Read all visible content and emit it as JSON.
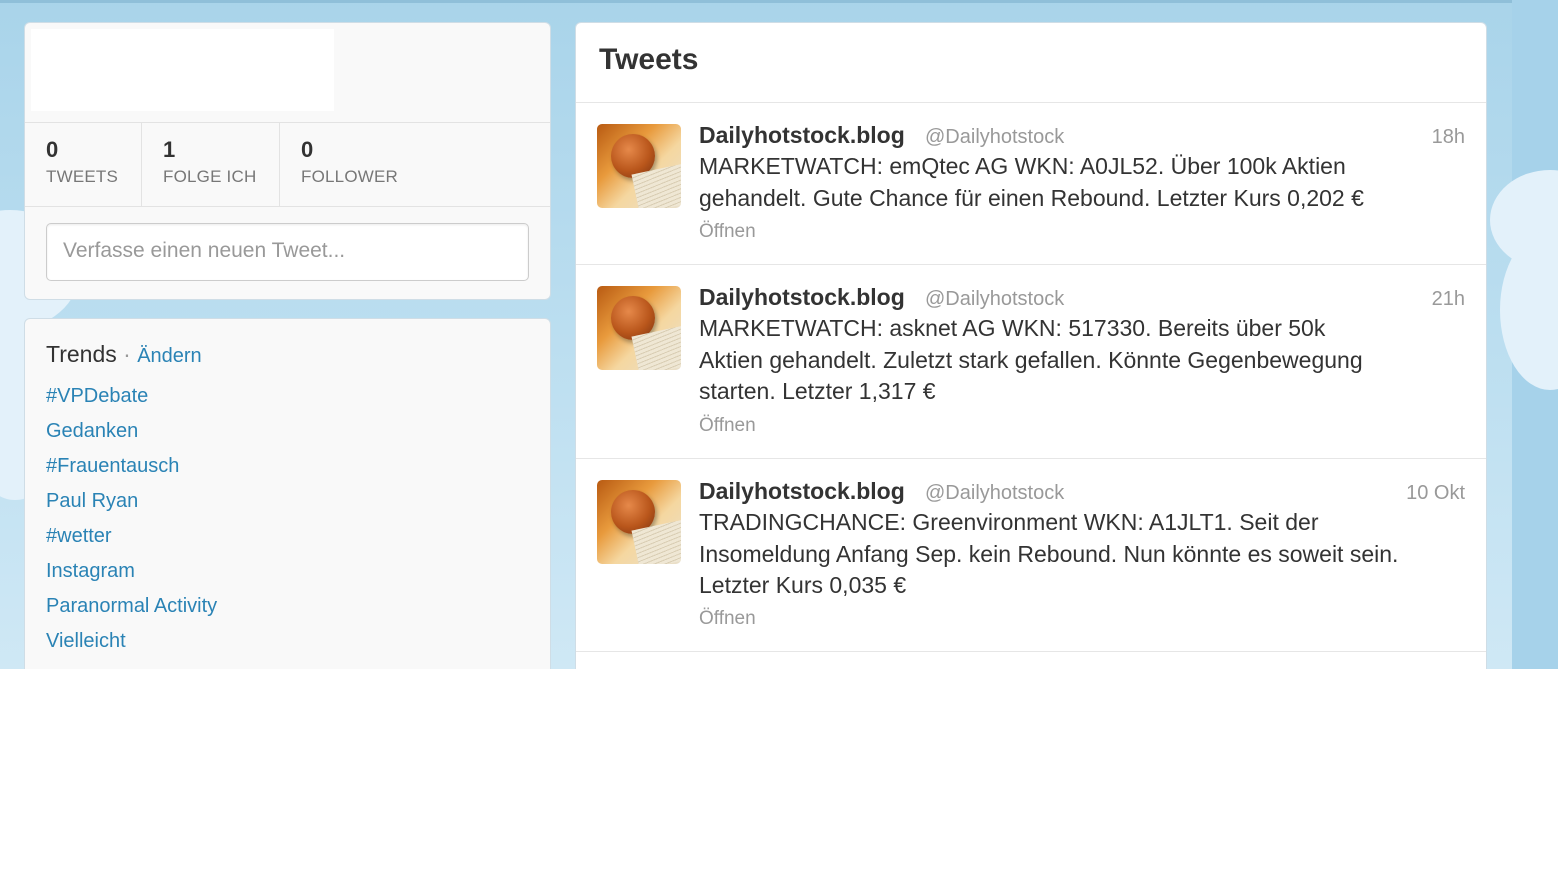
{
  "profile": {
    "stats": [
      {
        "num": "0",
        "label": "TWEETS"
      },
      {
        "num": "1",
        "label": "FOLGE ICH"
      },
      {
        "num": "0",
        "label": "FOLLOWER"
      }
    ],
    "compose_placeholder": "Verfasse einen neuen Tweet..."
  },
  "trends": {
    "title": "Trends",
    "separator": "·",
    "change_label": "Ändern",
    "items": [
      "#VPDebate",
      "Gedanken",
      "#Frauentausch",
      "Paul Ryan",
      "#wetter",
      "Instagram",
      "Paranormal Activity",
      "Vielleicht"
    ]
  },
  "timeline": {
    "title": "Tweets",
    "tweets": [
      {
        "name": "Dailyhotstock.blog",
        "handle": "@Dailyhotstock",
        "time": "18h",
        "lines": [
          "MARKETWATCH: emQtec AG WKN: A0JL52. Über 100k Aktien",
          "gehandelt. Gute Chance für einen Rebound. Letzter Kurs 0,202 €"
        ],
        "open_label": "Öffnen"
      },
      {
        "name": "Dailyhotstock.blog",
        "handle": "@Dailyhotstock",
        "time": "21h",
        "lines": [
          "MARKETWATCH: asknet AG WKN: 517330. Bereits über 50k",
          "Aktien gehandelt. Zuletzt stark gefallen. Könnte Gegenbewegung",
          "starten. Letzter 1,317 €"
        ],
        "open_label": "Öffnen"
      },
      {
        "name": "Dailyhotstock.blog",
        "handle": "@Dailyhotstock",
        "time": "10 Okt",
        "lines": [
          "TRADINGCHANCE: Greenvironment WKN: A1JLT1. Seit der",
          "Insomeldung Anfang Sep. kein Rebound. Nun könnte es soweit sein.",
          "Letzter Kurs 0,035 €"
        ],
        "open_label": "Öffnen"
      }
    ]
  }
}
